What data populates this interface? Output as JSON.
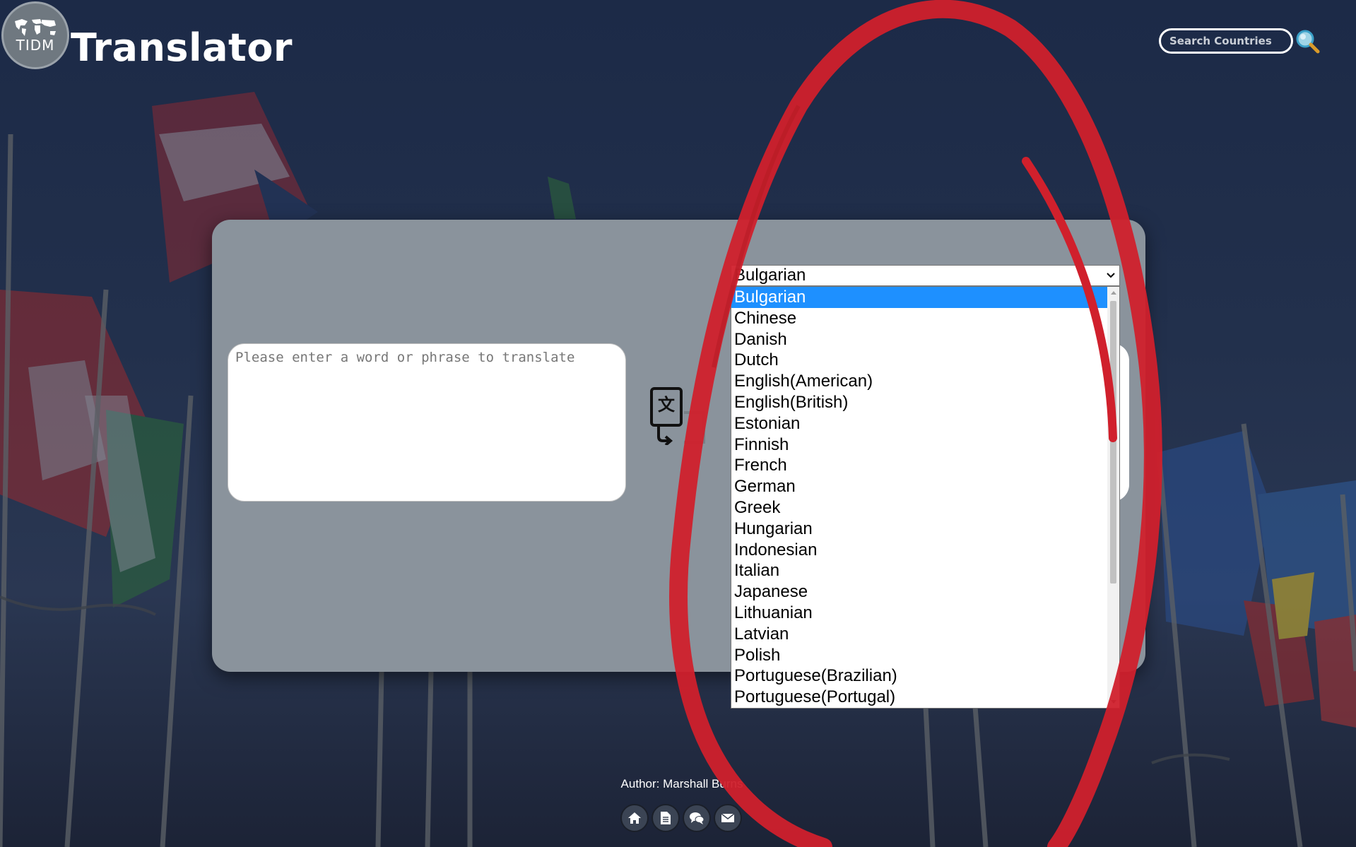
{
  "header": {
    "logo_text": "TIDM",
    "title": "Translator",
    "search_placeholder": "Search Countries"
  },
  "translator": {
    "source_placeholder": "Please enter a word or phrase to translate",
    "target_language": {
      "selected": "Bulgarian",
      "options": [
        "Bulgarian",
        "Chinese",
        "Danish",
        "Dutch",
        "English(American)",
        "English(British)",
        "Estonian",
        "Finnish",
        "French",
        "German",
        "Greek",
        "Hungarian",
        "Indonesian",
        "Italian",
        "Japanese",
        "Lithuanian",
        "Latvian",
        "Polish",
        "Portuguese(Brazilian)",
        "Portuguese(Portugal)"
      ]
    }
  },
  "footer": {
    "author": "Author: Marshall Burns",
    "icons": [
      "home-icon",
      "document-icon",
      "chat-icon",
      "mail-icon"
    ]
  },
  "colors": {
    "panel": "#8a939c",
    "highlight": "#1e90ff",
    "annotation_red": "#d0202c"
  }
}
